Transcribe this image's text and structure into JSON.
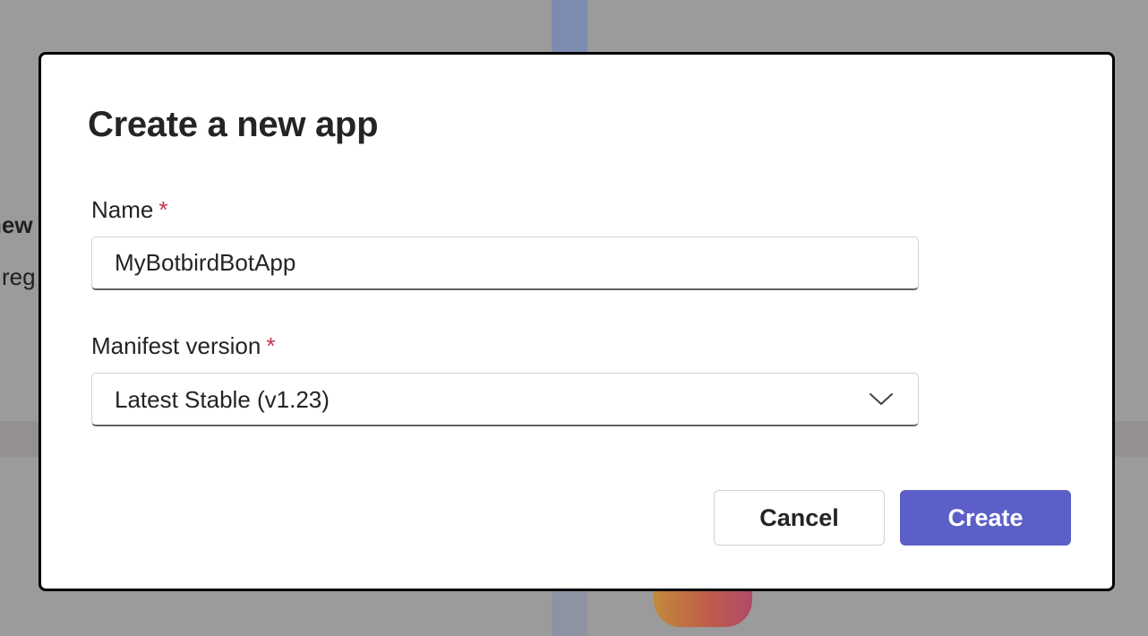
{
  "background": {
    "partial_heading": "new",
    "partial_text": "reg"
  },
  "dialog": {
    "title": "Create a new app",
    "name_field": {
      "label": "Name",
      "required_marker": "*",
      "value": "MyBotbirdBotApp"
    },
    "manifest_field": {
      "label": "Manifest version",
      "required_marker": "*",
      "selected_value": "Latest Stable (v1.23)",
      "icon": "chevron-down-icon"
    },
    "buttons": {
      "cancel_label": "Cancel",
      "create_label": "Create"
    }
  },
  "colors": {
    "primary": "#5b5fc7",
    "required": "#c4314b",
    "overlay": "#8f8f8f"
  }
}
